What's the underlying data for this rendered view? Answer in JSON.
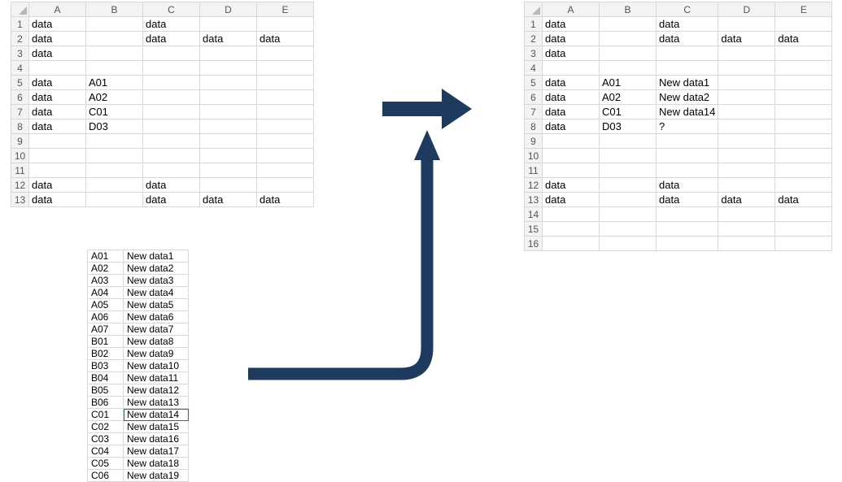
{
  "colors": {
    "arrow": "#1e3a5f"
  },
  "columns": [
    "A",
    "B",
    "C",
    "D",
    "E"
  ],
  "left_grid": {
    "rows": 13,
    "cells": {
      "1": {
        "A": "data",
        "C": "data"
      },
      "2": {
        "A": "data",
        "C": "data",
        "D": "data",
        "E": "data"
      },
      "3": {
        "A": "data"
      },
      "5": {
        "A": "data",
        "B": "A01"
      },
      "6": {
        "A": "data",
        "B": "A02"
      },
      "7": {
        "A": "data",
        "B": "C01"
      },
      "8": {
        "A": "data",
        "B": "D03"
      },
      "12": {
        "A": "data",
        "C": "data"
      },
      "13": {
        "A": "data",
        "C": "data",
        "D": "data",
        "E": "data"
      }
    }
  },
  "right_grid": {
    "rows": 16,
    "selected_col": "B",
    "cells": {
      "1": {
        "A": "data",
        "C": "data"
      },
      "2": {
        "A": "data",
        "C": "data",
        "D": "data",
        "E": "data"
      },
      "3": {
        "A": "data"
      },
      "5": {
        "A": "data",
        "B": "A01",
        "C": "New data1"
      },
      "6": {
        "A": "data",
        "B": "A02",
        "C": "New data2"
      },
      "7": {
        "A": "data",
        "B": "C01",
        "C": "New data14"
      },
      "8": {
        "A": "data",
        "B": "D03",
        "C": "?"
      },
      "12": {
        "A": "data",
        "C": "data"
      },
      "13": {
        "A": "data",
        "C": "data",
        "D": "data",
        "E": "data"
      }
    }
  },
  "lookup_table": {
    "highlight_row": 13,
    "rows": [
      {
        "k": "A01",
        "v": "New data1"
      },
      {
        "k": "A02",
        "v": "New data2"
      },
      {
        "k": "A03",
        "v": "New data3"
      },
      {
        "k": "A04",
        "v": "New data4"
      },
      {
        "k": "A05",
        "v": "New data5"
      },
      {
        "k": "A06",
        "v": "New data6"
      },
      {
        "k": "A07",
        "v": "New data7"
      },
      {
        "k": "B01",
        "v": "New data8"
      },
      {
        "k": "B02",
        "v": "New data9"
      },
      {
        "k": "B03",
        "v": "New data10"
      },
      {
        "k": "B04",
        "v": "New data11"
      },
      {
        "k": "B05",
        "v": "New data12"
      },
      {
        "k": "B06",
        "v": "New data13"
      },
      {
        "k": "C01",
        "v": "New data14"
      },
      {
        "k": "C02",
        "v": "New data15"
      },
      {
        "k": "C03",
        "v": "New data16"
      },
      {
        "k": "C04",
        "v": "New data17"
      },
      {
        "k": "C05",
        "v": "New data18"
      },
      {
        "k": "C06",
        "v": "New data19"
      }
    ]
  }
}
